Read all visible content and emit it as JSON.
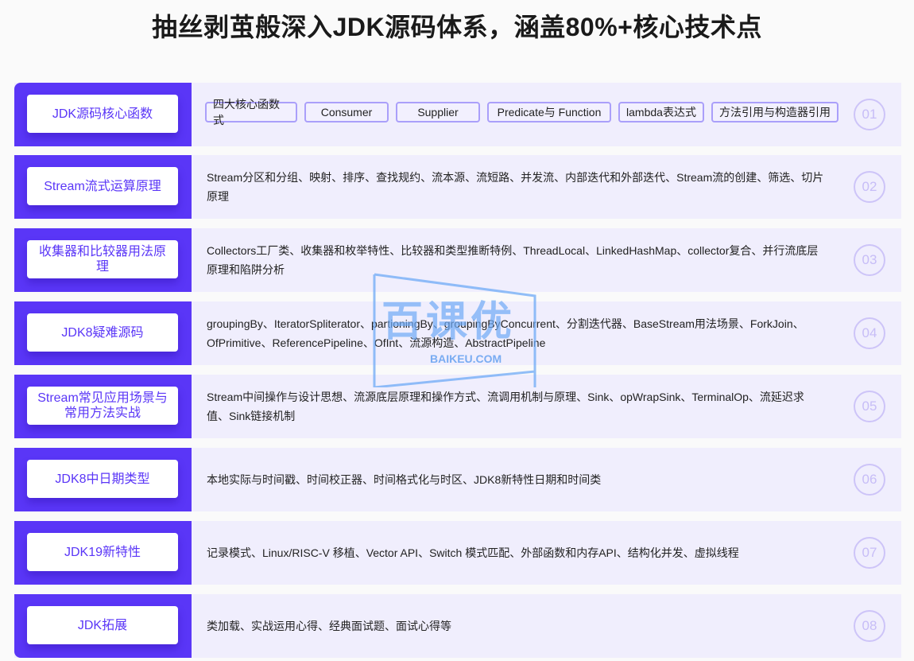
{
  "title": "抽丝剥茧般深入JDK源码体系，涵盖80%+核心技术点",
  "modules": [
    {
      "label": "JDK源码核心函数",
      "number": "01",
      "chips": [
        "四大核心函数式",
        "Consumer",
        "Supplier",
        "Predicate与 Function",
        "lambda表达式",
        "方法引用与构造器引用"
      ]
    },
    {
      "label": "Stream流式运算原理",
      "number": "02",
      "line1": "Stream分区和分组、映射、排序、查找规约、流本源、流短路、并发流、内部迭代和外部迭代、Stream流的创建、筛选、切片",
      "line2": "原理"
    },
    {
      "label": "收集器和比较器用法原理",
      "number": "03",
      "line1": "Collectors工厂类、收集器和枚举特性、比较器和类型推断特例、ThreadLocal、LinkedHashMap、collector复合、并行流底层",
      "line2": "原理和陷阱分析"
    },
    {
      "label": "JDK8疑难源码",
      "number": "04",
      "line1": "groupingBy、IteratorSpliterator、partioningBy、groupingByConcurrent、分割迭代器、BaseStream用法场景、ForkJoin、",
      "line2": "OfPrimitive、ReferencePipeline、OfInt、流源构造、AbstractPipeline"
    },
    {
      "label": "Stream常见应用场景与常用方法实战",
      "number": "05",
      "line1": "Stream中间操作与设计思想、流源底层原理和操作方式、流调用机制与原理、Sink、opWrapSink、TerminalOp、流延迟求",
      "line2": "值、Sink链接机制"
    },
    {
      "label": "JDK8中日期类型",
      "number": "06",
      "line1": "本地实际与时间戳、时间校正器、时间格式化与时区、JDK8新特性日期和时间类"
    },
    {
      "label": "JDK19新特性",
      "number": "07",
      "line1": "记录模式、Linux/RISC-V 移植、Vector API、Switch 模式匹配、外部函数和内存API、结构化并发、虚拟线程"
    },
    {
      "label": "JDK拓展",
      "number": "08",
      "line1": "类加载、实战运用心得、经典面试题、面试心得等"
    }
  ],
  "watermark": {
    "text": "百课优",
    "sub": "BAIKEU.COM"
  },
  "colors": {
    "accent": "#5a36f7",
    "panel": "#f0eefd",
    "chip_border": "#aa9ffa",
    "number": "#c7bdf7"
  }
}
